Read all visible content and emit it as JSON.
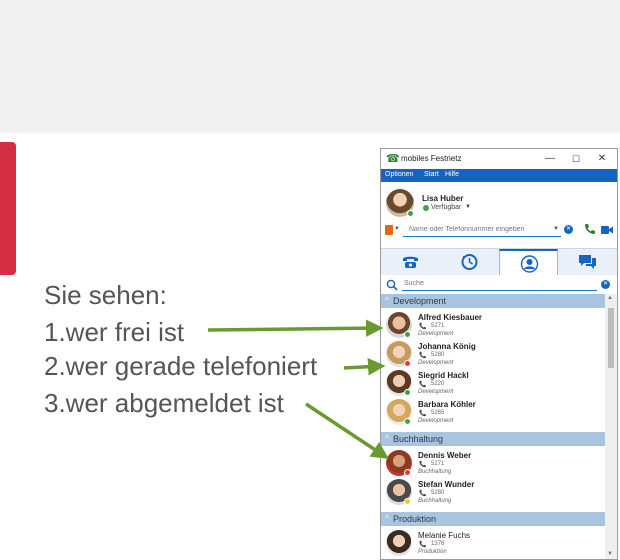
{
  "slide": {
    "lines": [
      "Sie sehen:",
      "1.wer frei ist",
      "2.wer gerade telefoniert",
      "3.wer abgemeldet ist"
    ],
    "colors": {
      "accent": "#d42e44",
      "arrow": "#6a9a2f",
      "text": "#555555"
    }
  },
  "window": {
    "title": "mobiles Festnetz",
    "controls": {
      "minimize": "—",
      "maximize": "☐",
      "close": "✕"
    },
    "menu": [
      "Optionen",
      "Start",
      "Hilfe"
    ]
  },
  "profile": {
    "name": "Lisa Huber",
    "status": "Verfügbar",
    "status_color": "#43a047"
  },
  "dial": {
    "placeholder": "Name oder Telefonnummer eingeben"
  },
  "tabs": [
    {
      "icon": "phone-icon"
    },
    {
      "icon": "history-icon"
    },
    {
      "icon": "contacts-icon",
      "active": true
    },
    {
      "icon": "chat-icon"
    }
  ],
  "search": {
    "placeholder": "Suche"
  },
  "groups": [
    {
      "label": "Development",
      "contacts": [
        {
          "name": "Alfred Kiesbauer",
          "ext": "5271",
          "dept": "Development",
          "status": "available"
        },
        {
          "name": "Johanna König",
          "ext": "5280",
          "dept": "Development",
          "status": "busy"
        },
        {
          "name": "Siegrid Hackl",
          "ext": "5220",
          "dept": "Development",
          "status": "available"
        },
        {
          "name": "Barbara Köhler",
          "ext": "5265",
          "dept": "Development",
          "status": "available"
        }
      ]
    },
    {
      "label": "Buchhaltung",
      "contacts": [
        {
          "name": "Dennis Weber",
          "ext": "5271",
          "dept": "Buchhaltung",
          "status": "dnd"
        },
        {
          "name": "Stefan Wunder",
          "ext": "5280",
          "dept": "Buchhaltung",
          "status": "away"
        }
      ]
    },
    {
      "label": "Produktion",
      "contacts": [
        {
          "name": "Melanie Fuchs",
          "ext": "1378",
          "dept": "Produktion",
          "status": "none"
        }
      ]
    }
  ],
  "status_colors": {
    "available": "#43a047",
    "busy": "#e53935",
    "dnd": "#e53935",
    "away": "#fbc02d"
  }
}
